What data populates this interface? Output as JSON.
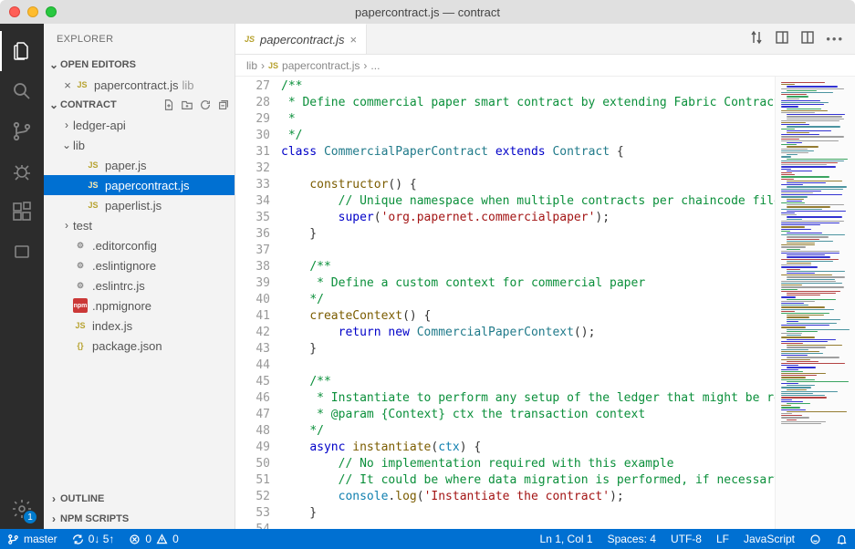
{
  "window": {
    "title": "papercontract.js — contract"
  },
  "sidebar": {
    "header": "EXPLORER",
    "openEditorsLabel": "OPEN EDITORS",
    "openEditor": {
      "name": "papercontract.js",
      "dir": "lib"
    },
    "workspaceLabel": "CONTRACT",
    "tree": {
      "ledgerApi": "ledger-api",
      "lib": "lib",
      "paper": "paper.js",
      "papercontract": "papercontract.js",
      "paperlist": "paperlist.js",
      "test": "test",
      "editorconfig": ".editorconfig",
      "eslintignore": ".eslintignore",
      "eslintrc": ".eslintrc.js",
      "npmignore": ".npmignore",
      "indexjs": "index.js",
      "packagejson": "package.json"
    },
    "outline": "OUTLINE",
    "npmScripts": "NPM SCRIPTS"
  },
  "settingsBadge": "1",
  "tabbar": {
    "tabName": "papercontract.js",
    "breadcrumbLib": "lib",
    "breadcrumbFile": "papercontract.js",
    "breadcrumbDots": "..."
  },
  "code": {
    "firstLine": 27,
    "lines": [
      [
        [
          "c-comment",
          "/**"
        ]
      ],
      [
        [
          "c-comment",
          " * Define commercial paper smart contract by extending Fabric Contract cl"
        ]
      ],
      [
        [
          "c-comment",
          " *"
        ]
      ],
      [
        [
          "c-comment",
          " */"
        ]
      ],
      [
        [
          "c-key",
          "class "
        ],
        [
          "c-cls",
          "CommercialPaperContract"
        ],
        [
          "c-plain",
          " "
        ],
        [
          "c-key",
          "extends"
        ],
        [
          "c-plain",
          " "
        ],
        [
          "c-cls",
          "Contract"
        ],
        [
          "c-plain",
          " {"
        ]
      ],
      [
        [
          "c-plain",
          ""
        ]
      ],
      [
        [
          "c-plain",
          "    "
        ],
        [
          "c-fn",
          "constructor"
        ],
        [
          "c-punc",
          "() {"
        ]
      ],
      [
        [
          "c-plain",
          "        "
        ],
        [
          "c-comment",
          "// Unique namespace when multiple contracts per chaincode file"
        ]
      ],
      [
        [
          "c-plain",
          "        "
        ],
        [
          "c-key",
          "super"
        ],
        [
          "c-punc",
          "("
        ],
        [
          "c-str",
          "'org.papernet.commercialpaper'"
        ],
        [
          "c-punc",
          ");"
        ]
      ],
      [
        [
          "c-plain",
          "    }"
        ]
      ],
      [
        [
          "c-plain",
          ""
        ]
      ],
      [
        [
          "c-plain",
          "    "
        ],
        [
          "c-comment",
          "/**"
        ]
      ],
      [
        [
          "c-plain",
          "     "
        ],
        [
          "c-comment",
          "* Define a custom context for commercial paper"
        ]
      ],
      [
        [
          "c-plain",
          "    "
        ],
        [
          "c-comment",
          "*/"
        ]
      ],
      [
        [
          "c-plain",
          "    "
        ],
        [
          "c-fn",
          "createContext"
        ],
        [
          "c-punc",
          "() {"
        ]
      ],
      [
        [
          "c-plain",
          "        "
        ],
        [
          "c-key",
          "return new"
        ],
        [
          "c-plain",
          " "
        ],
        [
          "c-cls",
          "CommercialPaperContext"
        ],
        [
          "c-punc",
          "();"
        ]
      ],
      [
        [
          "c-plain",
          "    }"
        ]
      ],
      [
        [
          "c-plain",
          ""
        ]
      ],
      [
        [
          "c-plain",
          "    "
        ],
        [
          "c-comment",
          "/**"
        ]
      ],
      [
        [
          "c-plain",
          "     "
        ],
        [
          "c-comment",
          "* Instantiate to perform any setup of the ledger that might be requi"
        ]
      ],
      [
        [
          "c-plain",
          "     "
        ],
        [
          "c-comment",
          "* @param {Context} ctx the transaction context"
        ]
      ],
      [
        [
          "c-plain",
          "    "
        ],
        [
          "c-comment",
          "*/"
        ]
      ],
      [
        [
          "c-plain",
          "    "
        ],
        [
          "c-key",
          "async"
        ],
        [
          "c-plain",
          " "
        ],
        [
          "c-fn",
          "instantiate"
        ],
        [
          "c-punc",
          "("
        ],
        [
          "c-param",
          "ctx"
        ],
        [
          "c-punc",
          ") {"
        ]
      ],
      [
        [
          "c-plain",
          "        "
        ],
        [
          "c-comment",
          "// No implementation required with this example"
        ]
      ],
      [
        [
          "c-plain",
          "        "
        ],
        [
          "c-comment",
          "// It could be where data migration is performed, if necessary"
        ]
      ],
      [
        [
          "c-plain",
          "        "
        ],
        [
          "c-obj",
          "console"
        ],
        [
          "c-punc",
          "."
        ],
        [
          "c-fn",
          "log"
        ],
        [
          "c-punc",
          "("
        ],
        [
          "c-str",
          "'Instantiate the contract'"
        ],
        [
          "c-punc",
          ");"
        ]
      ],
      [
        [
          "c-plain",
          "    }"
        ]
      ],
      [
        [
          "c-plain",
          ""
        ]
      ]
    ]
  },
  "status": {
    "branch": "master",
    "sync": "0↓ 5↑",
    "errors": "0",
    "warnings": "0",
    "lncol": "Ln 1, Col 1",
    "spaces": "Spaces: 4",
    "encoding": "UTF-8",
    "eol": "LF",
    "lang": "JavaScript"
  }
}
